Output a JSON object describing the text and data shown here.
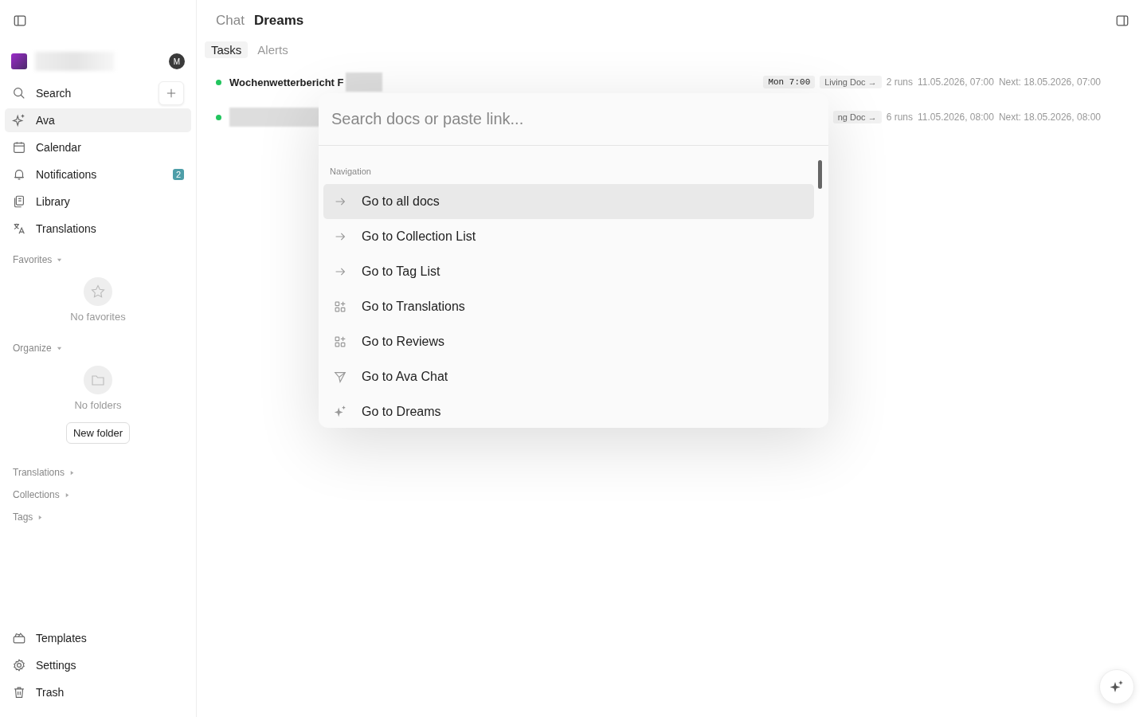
{
  "sidebar": {
    "nav": [
      {
        "label": "Search",
        "selected": false
      },
      {
        "label": "Ava",
        "selected": true
      },
      {
        "label": "Calendar",
        "selected": false
      },
      {
        "label": "Notifications",
        "selected": false,
        "badge": "2"
      },
      {
        "label": "Library",
        "selected": false
      },
      {
        "label": "Translations",
        "selected": false
      }
    ],
    "avatar": "M",
    "favorites": {
      "title": "Favorites",
      "empty": "No favorites",
      "expanded": true
    },
    "organize": {
      "title": "Organize",
      "empty": "No folders",
      "button": "New folder",
      "expanded": true
    },
    "groups": [
      {
        "label": "Translations",
        "expanded": false
      },
      {
        "label": "Collections",
        "expanded": false
      },
      {
        "label": "Tags",
        "expanded": false
      }
    ],
    "footer": [
      {
        "label": "Templates"
      },
      {
        "label": "Settings"
      },
      {
        "label": "Trash"
      }
    ]
  },
  "header": {
    "breadcrumb": [
      "Chat",
      "Dreams"
    ]
  },
  "tabs": [
    {
      "label": "Tasks",
      "selected": true
    },
    {
      "label": "Alerts",
      "selected": false
    }
  ],
  "tasks": [
    {
      "title": "Wochenwetterbericht F",
      "color": "#22c55e",
      "schedule": "Mon 7:00",
      "link": "Living Doc →",
      "runs": "2 runs",
      "last": "11.05.2026, 07:00",
      "next": "Next: 18.05.2026, 07:00"
    },
    {
      "color": "#22c55e",
      "link": "ng Doc →",
      "runs": "6 runs",
      "last": "11.05.2026, 08:00",
      "next": "Next: 18.05.2026, 08:00"
    }
  ],
  "palette": {
    "placeholder": "Search docs or paste link...",
    "section": "Navigation",
    "items": [
      {
        "label": "Go to all docs",
        "selected": true
      },
      {
        "label": "Go to Collection List",
        "selected": false
      },
      {
        "label": "Go to Tag List",
        "selected": false
      },
      {
        "label": "Go to Translations",
        "selected": false
      },
      {
        "label": "Go to Reviews",
        "selected": false
      },
      {
        "label": "Go to Ava Chat",
        "selected": false
      },
      {
        "label": "Go to Dreams",
        "selected": false
      }
    ]
  }
}
